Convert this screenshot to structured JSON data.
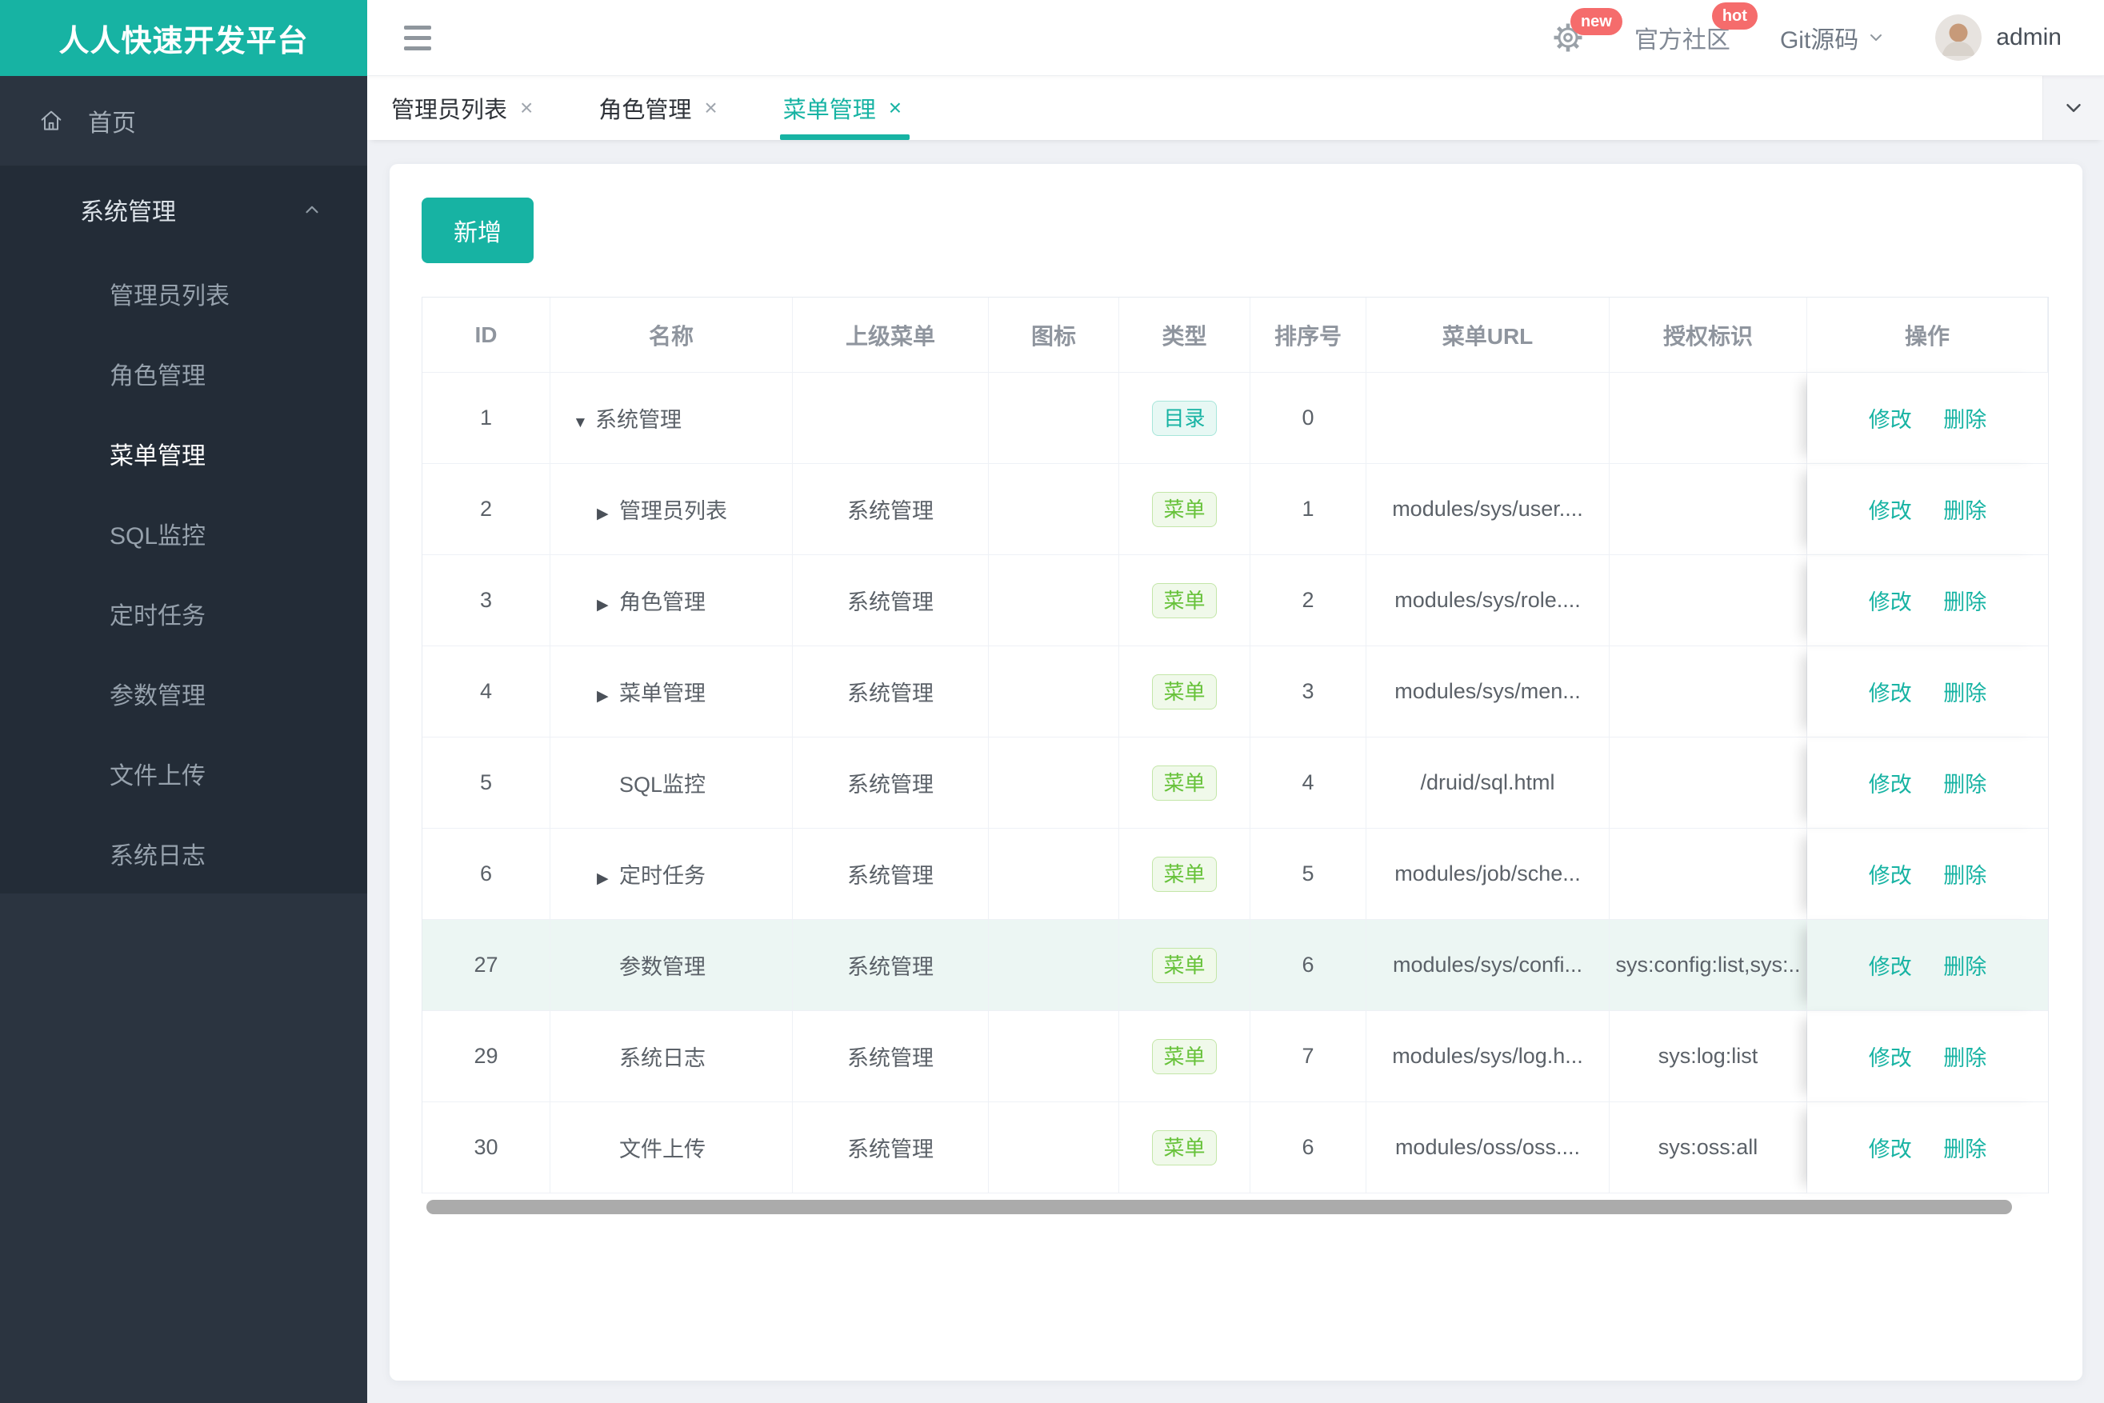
{
  "colors": {
    "accent": "#17b3a3",
    "danger": "#f56c6c",
    "success": "#67c23a",
    "row-highlight": "#ecf6f3"
  },
  "sidebar": {
    "logo": "人人快速开发平台",
    "home": "首页",
    "group": {
      "label": "系统管理",
      "items": [
        {
          "label": "管理员列表",
          "state": ""
        },
        {
          "label": "角色管理",
          "state": ""
        },
        {
          "label": "菜单管理",
          "state": "active"
        },
        {
          "label": "SQL监控",
          "state": ""
        },
        {
          "label": "定时任务",
          "state": ""
        },
        {
          "label": "参数管理",
          "state": ""
        },
        {
          "label": "文件上传",
          "state": ""
        },
        {
          "label": "系统日志",
          "state": ""
        }
      ]
    }
  },
  "topbar": {
    "settings_badge": "new",
    "community": "官方社区",
    "community_badge": "hot",
    "git": "Git源码",
    "username": "admin"
  },
  "tabbar": {
    "close_glyph": "×",
    "tabs": [
      {
        "label": "管理员列表",
        "state": ""
      },
      {
        "label": "角色管理",
        "state": ""
      },
      {
        "label": "菜单管理",
        "state": "active"
      }
    ]
  },
  "main": {
    "add_button": "新增"
  },
  "table": {
    "columns": [
      "ID",
      "名称",
      "上级菜单",
      "图标",
      "类型",
      "排序号",
      "菜单URL",
      "授权标识",
      "操作"
    ],
    "actions": {
      "edit": "修改",
      "delete": "删除"
    },
    "rows": [
      {
        "id": "1",
        "level": "root",
        "arrow": "▼",
        "name": "系统管理",
        "parent": "",
        "type_label": "目录",
        "type_variant": "dir",
        "order": "0",
        "url": "",
        "perm": "",
        "state": ""
      },
      {
        "id": "2",
        "level": "child",
        "arrow": "▶",
        "name": "管理员列表",
        "parent": "系统管理",
        "type_label": "菜单",
        "type_variant": "menu",
        "order": "1",
        "url": "modules/sys/user....",
        "perm": "",
        "state": ""
      },
      {
        "id": "3",
        "level": "child",
        "arrow": "▶",
        "name": "角色管理",
        "parent": "系统管理",
        "type_label": "菜单",
        "type_variant": "menu",
        "order": "2",
        "url": "modules/sys/role....",
        "perm": "",
        "state": ""
      },
      {
        "id": "4",
        "level": "child",
        "arrow": "▶",
        "name": "菜单管理",
        "parent": "系统管理",
        "type_label": "菜单",
        "type_variant": "menu",
        "order": "3",
        "url": "modules/sys/men...",
        "perm": "",
        "state": ""
      },
      {
        "id": "5",
        "level": "child",
        "arrow": "",
        "name": "SQL监控",
        "parent": "系统管理",
        "type_label": "菜单",
        "type_variant": "menu",
        "order": "4",
        "url": "/druid/sql.html",
        "perm": "",
        "state": ""
      },
      {
        "id": "6",
        "level": "child",
        "arrow": "▶",
        "name": "定时任务",
        "parent": "系统管理",
        "type_label": "菜单",
        "type_variant": "menu",
        "order": "5",
        "url": "modules/job/sche...",
        "perm": "",
        "state": ""
      },
      {
        "id": "27",
        "level": "child",
        "arrow": "",
        "name": "参数管理",
        "parent": "系统管理",
        "type_label": "菜单",
        "type_variant": "menu",
        "order": "6",
        "url": "modules/sys/confi...",
        "perm": "sys:config:list,sys:..",
        "state": "highlight"
      },
      {
        "id": "29",
        "level": "child",
        "arrow": "",
        "name": "系统日志",
        "parent": "系统管理",
        "type_label": "菜单",
        "type_variant": "menu",
        "order": "7",
        "url": "modules/sys/log.h...",
        "perm": "sys:log:list",
        "state": ""
      },
      {
        "id": "30",
        "level": "child",
        "arrow": "",
        "name": "文件上传",
        "parent": "系统管理",
        "type_label": "菜单",
        "type_variant": "menu",
        "order": "6",
        "url": "modules/oss/oss....",
        "perm": "sys:oss:all",
        "state": ""
      }
    ]
  }
}
